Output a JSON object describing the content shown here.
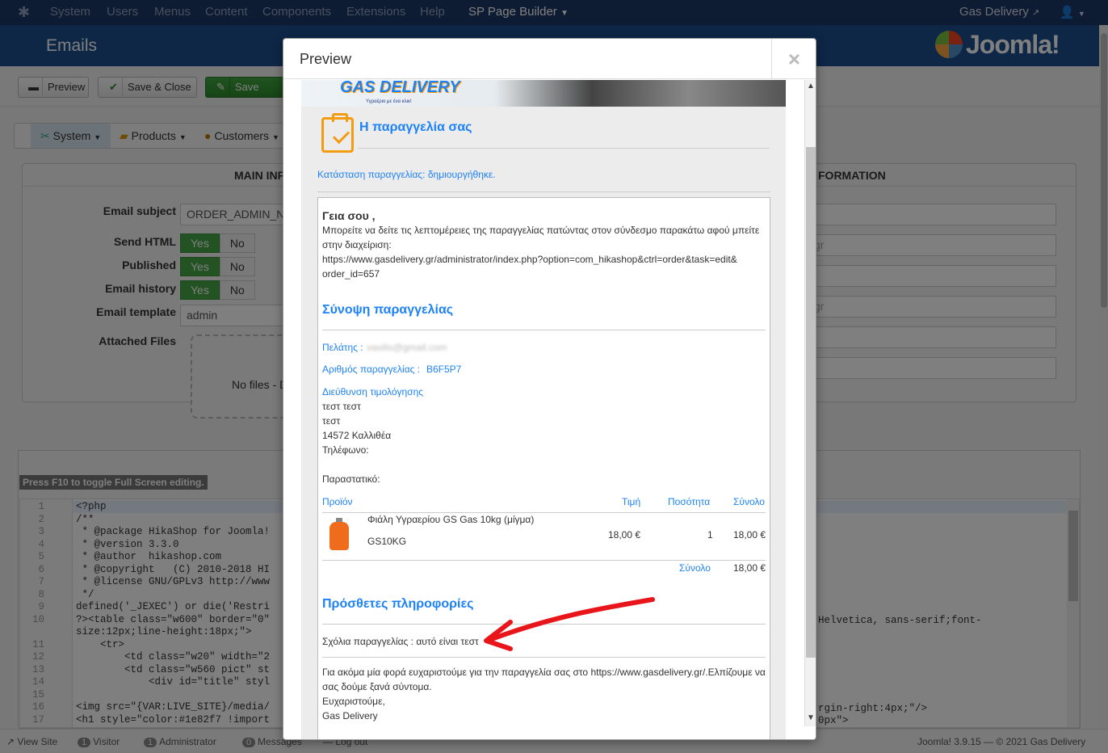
{
  "topnav": {
    "items": [
      "System",
      "Users",
      "Menus",
      "Content",
      "Components",
      "Extensions",
      "Help"
    ],
    "sp_page_builder": "SP Page Builder",
    "site_name": "Gas Delivery"
  },
  "header": {
    "title": "Emails",
    "brand": "Joomla!"
  },
  "toolbar": {
    "preview": "Preview",
    "save_close": "Save & Close",
    "save": "Save"
  },
  "subnav": {
    "system": "System",
    "products": "Products",
    "customers": "Customers"
  },
  "main_panel": {
    "title_left": "MAIN INFO",
    "title_right": "FORMATION"
  },
  "form": {
    "email_subject_label": "Email subject",
    "email_subject_value": "ORDER_ADMIN_NOTIFICATION",
    "send_html_label": "Send HTML",
    "published_label": "Published",
    "email_history_label": "Email history",
    "email_template_label": "Email template",
    "email_template_value": "admin",
    "attached_files_label": "Attached Files",
    "no_files": "No files - D",
    "yes": "Yes",
    "no": "No",
    "right_value_1": "gr",
    "right_value_2": "gr"
  },
  "editor": {
    "hint": "Press F10 to toggle Full Screen editing.",
    "lines": [
      {
        "n": "1",
        "t": "<?php"
      },
      {
        "n": "2",
        "t": "/**"
      },
      {
        "n": "3",
        "t": " * @package HikaShop for Joomla!"
      },
      {
        "n": "4",
        "t": " * @version 3.3.0"
      },
      {
        "n": "5",
        "t": " * @author  hikashop.com"
      },
      {
        "n": "6",
        "t": " * @copyright   (C) 2010-2018 HI"
      },
      {
        "n": "7",
        "t": " * @license GNU/GPLv3 http://www"
      },
      {
        "n": "8",
        "t": " */"
      },
      {
        "n": "9",
        "t": "defined('_JEXEC') or die('Restri"
      },
      {
        "n": "10",
        "t": "?><table class=\"w600\" border=\"0\""
      },
      {
        "n": "",
        "t": "size:12px;line-height:18px;\">"
      },
      {
        "n": "11",
        "t": "    <tr>"
      },
      {
        "n": "12",
        "t": "        <td class=\"w20\" width=\"2"
      },
      {
        "n": "13",
        "t": "        <td class=\"w560 pict\" st"
      },
      {
        "n": "14",
        "t": "            <div id=\"title\" styl"
      },
      {
        "n": "15",
        "t": ""
      },
      {
        "n": "16",
        "t": "<img src=\"{VAR:LIVE_SITE}/media/"
      },
      {
        "n": "17",
        "t": "<h1 style=\"color:#1e82f7 !import"
      }
    ],
    "right_line_10": "Helvetica, sans-serif;font-",
    "right_line_16": "rgin-right:4px;\"/>",
    "right_line_17": "0px\">"
  },
  "statusbar": {
    "view_site": "View Site",
    "visitor_count": "1",
    "visitor": "Visitor",
    "admin_count": "1",
    "administrator": "Administrator",
    "messages_count": "0",
    "messages": "Messages",
    "logout": "Log out",
    "footer": "Joomla! 3.9.15 — © 2021 Gas Delivery"
  },
  "modal": {
    "title": "Preview",
    "close": "×",
    "email": {
      "logo": "GAS DELIVERY",
      "logo_tagline": "Υγραέριο με ένα κλικ!",
      "heading": "Η παραγγελία σας",
      "status": "Κατάσταση παραγγελίας: δημιουργήθηκε.",
      "greeting": "Γεια σου ,",
      "intro_1": "Μπορείτε να δείτε τις λεπτομέρειες της παραγγελίας πατώντας στον σύνδεσμο παρακάτω αφού μπείτε",
      "intro_2": "στην διαχείριση:",
      "link_1": "https://www.gasdelivery.gr/administrator/index.php?option=com_hikashop&ctrl=order&task=edit&",
      "link_2": "order_id=657",
      "summary_title": "Σύνοψη παραγγελίας",
      "customer_label": "Πελάτης :",
      "customer_value": "vasilis@gmail.com",
      "order_no_label": "Αριθμός παραγγελίας :",
      "order_no_value": "B6F5P7",
      "billing_title": "Διεύθυνση τιμολόγησης",
      "billing_lines": [
        "τεστ τεστ",
        "τεστ",
        "14572 Καλλιθέα",
        "Τηλέφωνο:"
      ],
      "receipt": "Παραστατικό:",
      "th_product": "Προϊόν",
      "th_price": "Τιμή",
      "th_qty": "Ποσότητα",
      "th_total": "Σύνολο",
      "product_name": "Φιάλη Υγραερίου GS Gas 10kg (μίγμα)",
      "product_code": "GS10KG",
      "product_price": "18,00 €",
      "product_qty": "1",
      "product_total": "18,00 €",
      "sum_label": "Σύνολο",
      "sum_value": "18,00 €",
      "extra_title": "Πρόσθετες πληροφορίες",
      "comment": "Σχόλια παραγγελίας : αυτό είναι τεστ",
      "thanks_1": "Για ακόμα μία φορά ευχαριστούμε για την παραγγελία σας στο https://www.gasdelivery.gr/.Ελπίζουμε να",
      "thanks_2": "σας δούμε ξανά σύντομα.",
      "thanks_3": "Ευχαριστούμε,",
      "signature": "Gas Delivery"
    }
  },
  "colors": {
    "accent": "#1e82f7",
    "annotation_arrow": "#e8161b",
    "header": "#1d4f8f",
    "topnav": "#1a3867"
  }
}
